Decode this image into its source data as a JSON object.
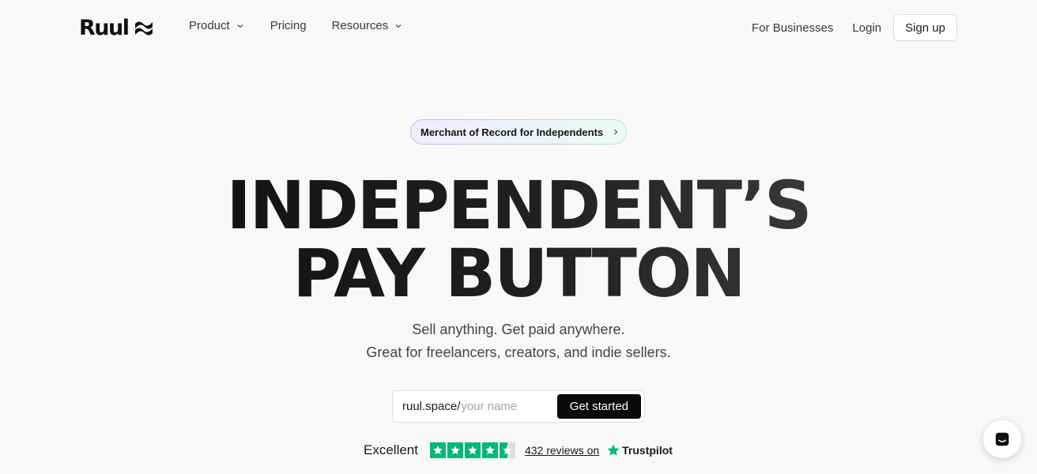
{
  "nav": {
    "logo_text": "Ruul",
    "links": [
      {
        "label": "Product",
        "has_dropdown": true
      },
      {
        "label": "Pricing",
        "has_dropdown": false
      },
      {
        "label": "Resources",
        "has_dropdown": true
      }
    ],
    "for_businesses": "For Businesses",
    "login": "Login",
    "signup": "Sign up"
  },
  "hero": {
    "badge": "Merchant of Record for Independents",
    "headline_line1": "INDEPENDENT’S",
    "headline_line2": "PAY BUTTON",
    "subtitle_line1": "Sell anything. Get paid anywhere.",
    "subtitle_line2": "Great for freelancers, creators, and indie sellers."
  },
  "signup_form": {
    "prefix": "ruul.space/",
    "placeholder": "your name",
    "value": "",
    "button": "Get started"
  },
  "trustpilot": {
    "rating_label": "Excellent",
    "stars": 4.5,
    "reviews_text": "432 reviews on",
    "brand": "Trustpilot",
    "star_color": "#00b67a"
  },
  "icons": {
    "chevron": "chevron-down-icon",
    "chat": "chat-icon",
    "star": "star-icon"
  },
  "colors": {
    "background": "#f8f8f8",
    "cta_bg": "#0a0a0a",
    "trustpilot_green": "#00b67a"
  }
}
